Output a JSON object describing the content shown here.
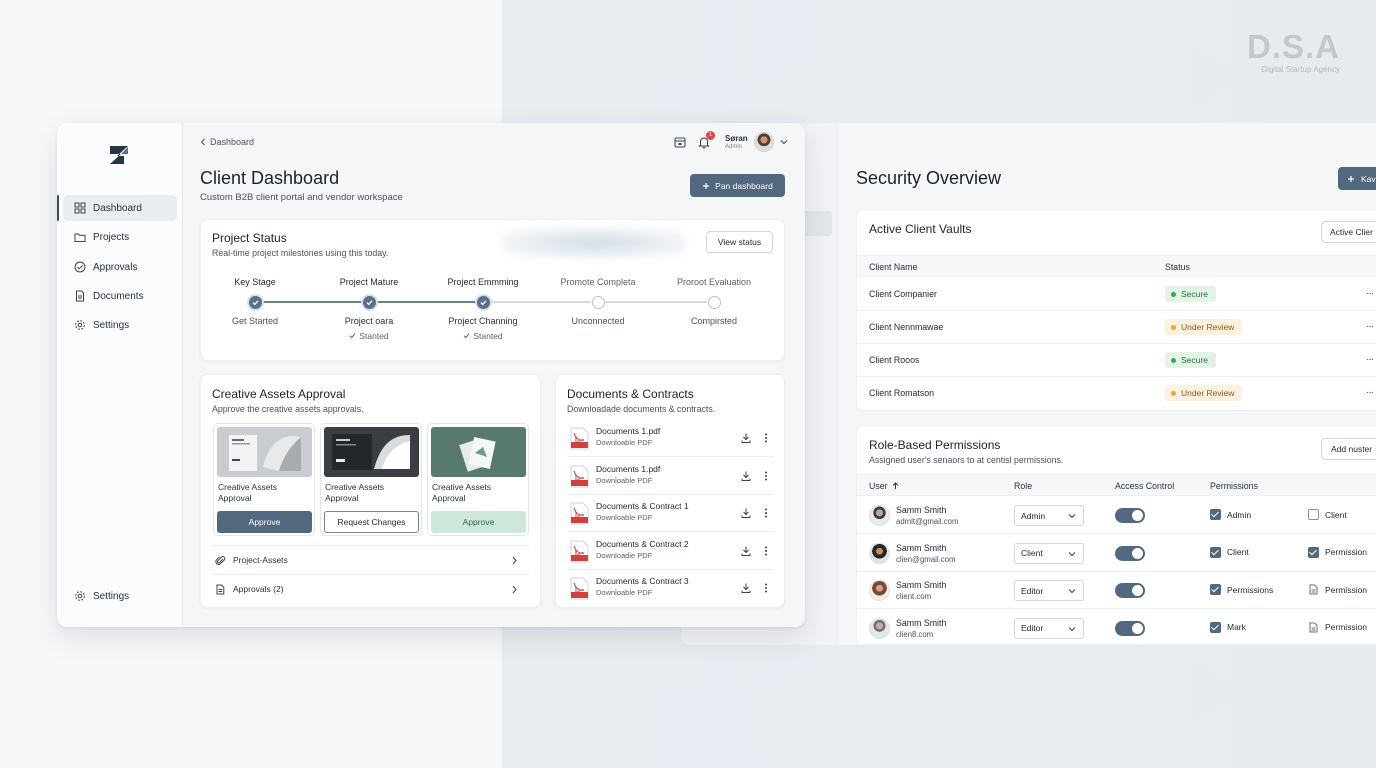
{
  "brand": {
    "name": "D.S.A",
    "tagline": "Digital Startup Agency"
  },
  "sidebar": {
    "items": [
      {
        "label": "Dashboard",
        "icon": "grid-icon",
        "active": true
      },
      {
        "label": "Projects",
        "icon": "folder-icon"
      },
      {
        "label": "Approvals",
        "icon": "check-circle-icon"
      },
      {
        "label": "Documents",
        "icon": "document-icon"
      },
      {
        "label": "Settings",
        "icon": "gear-icon"
      }
    ],
    "bottom_settings": "Settings"
  },
  "header": {
    "breadcrumb": "Dashboard",
    "notification_count": "1",
    "user_name": "Søran",
    "user_role": "Admin"
  },
  "page": {
    "title": "Client Dashboard",
    "subtitle": "Custom B2B client portal and vendor workspace",
    "primary_button": "Pan dashboard"
  },
  "project_status": {
    "title": "Project Status",
    "subtitle": "Real-time project milestones using this today.",
    "button": "View status",
    "stages": [
      {
        "name": "Key Stage",
        "lower": "Get Started",
        "note": "",
        "done": true
      },
      {
        "name": "Project Mature",
        "lower": "Project oara",
        "note": "Stanted",
        "done": true
      },
      {
        "name": "Project Emmming",
        "lower": "Project Channing",
        "note": "Stanted",
        "done": true
      },
      {
        "name": "Promote Completa",
        "lower": "Unconnected",
        "note": "",
        "done": false
      },
      {
        "name": "Proroot Evaluation",
        "lower": "Compirsted",
        "note": "",
        "done": false
      }
    ]
  },
  "creative": {
    "title": "Creative Assets Approval",
    "subtitle": "Approve the creative assets approvals.",
    "items": [
      {
        "label": "Creative Assets Approval",
        "button": "Approve"
      },
      {
        "label": "Creative Assets Approval",
        "button": "Request Changes"
      },
      {
        "label": "Creative Assets Approval",
        "button": "Approve"
      }
    ],
    "links": [
      {
        "label": "Project-Assets"
      },
      {
        "label": "Approvals (2)"
      }
    ]
  },
  "documents": {
    "title": "Documents & Contracts",
    "subtitle": "Downloadade documents & contracts.",
    "items": [
      {
        "name": "Documents 1.pdf",
        "type": "Downloable PDF"
      },
      {
        "name": "Documents 1.pdf",
        "type": "Downloable PDF"
      },
      {
        "name": "Documents & Contract 1",
        "type": "Downloable PDF"
      },
      {
        "name": "Documents & Contract 2",
        "type": "Downloadie PDF"
      },
      {
        "name": "Documents & Contract 3",
        "type": "Downloable PDF"
      }
    ]
  },
  "security": {
    "title": "Security Overview",
    "button": "Kav",
    "vaults": {
      "title": "Active Client Vaults",
      "button": "Active Clier",
      "col_name": "Client Name",
      "col_status": "Status",
      "rows": [
        {
          "name": "Client Companier",
          "status": "Secure",
          "kind": "secure"
        },
        {
          "name": "Client Nennmawae",
          "status": "Under Review",
          "kind": "review"
        },
        {
          "name": "Client Rooos",
          "status": "Secure",
          "kind": "secure"
        },
        {
          "name": "Client Romatson",
          "status": "Under Review",
          "kind": "review"
        }
      ],
      "more": "···"
    },
    "permissions": {
      "title": "Role-Based Permissions",
      "subtitle": "Assigned user's senaors to at centisl permissions.",
      "button": "Add nuster",
      "cols": {
        "user": "User",
        "role": "Role",
        "access": "Access Control",
        "permissions": "Permissions"
      },
      "rows": [
        {
          "name": "Samm Smith",
          "email": "admlt@gmail.com",
          "role": "Admin",
          "p1": "Admin",
          "p1_on": true,
          "p2": "Client",
          "p2_icon": "checkbox-empty-icon"
        },
        {
          "name": "Samm Smith",
          "email": "clien@gmail.com",
          "role": "Client",
          "p1": "Client",
          "p1_on": true,
          "p2": "Permission",
          "p2_icon": "checkbox-checked-icon"
        },
        {
          "name": "Samm Smith",
          "email": "client.com",
          "role": "Editor",
          "p1": "Permissions",
          "p1_on": true,
          "p2": "Permission",
          "p2_icon": "file-icon"
        },
        {
          "name": "Samm Smith",
          "email": "clien8.com",
          "role": "Editor",
          "p1": "Mark",
          "p1_on": true,
          "p2": "Permission",
          "p2_icon": "file-icon"
        }
      ]
    }
  },
  "colors": {
    "accent": "#51687f",
    "secure": "#34a853",
    "review": "#f0a62b",
    "badge": "#e54848"
  }
}
